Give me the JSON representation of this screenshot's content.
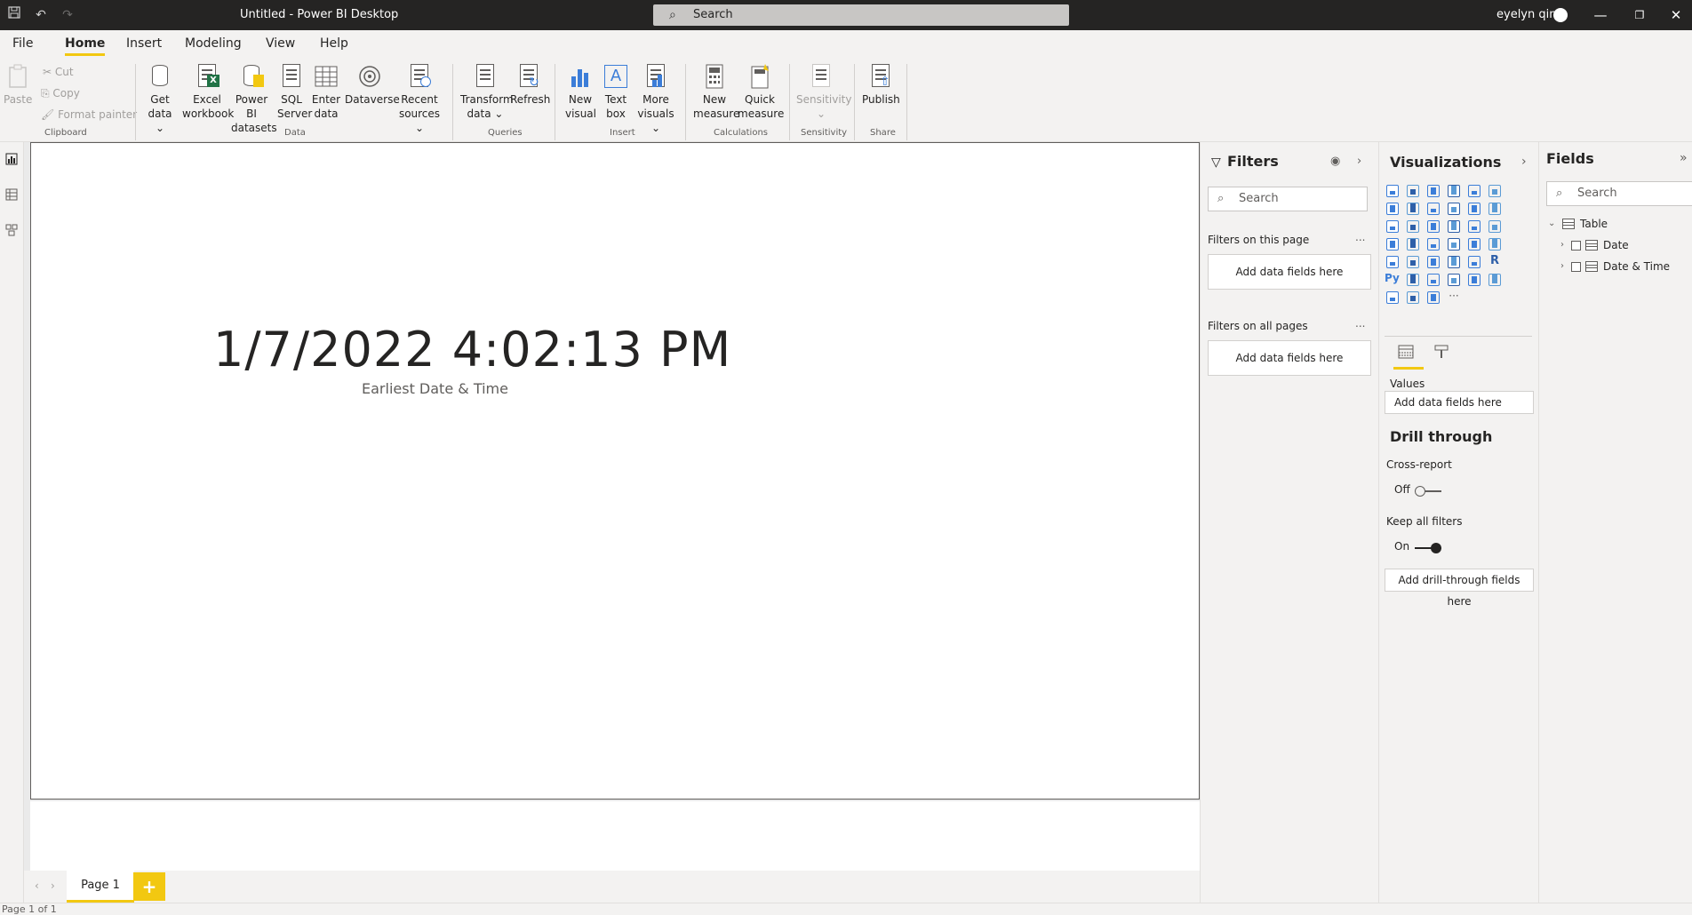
{
  "titlebar": {
    "title": "Untitled - Power BI Desktop",
    "search_placeholder": "Search",
    "user_name": "eyelyn qin"
  },
  "menu": {
    "tabs": [
      "File",
      "Home",
      "Insert",
      "Modeling",
      "View",
      "Help"
    ],
    "active": "Home"
  },
  "ribbon": {
    "clipboard": {
      "paste": "Paste",
      "cut": "Cut",
      "copy": "Copy",
      "format_painter": "Format painter",
      "group": "Clipboard"
    },
    "data": {
      "get_data": [
        "Get",
        "data ⌄"
      ],
      "excel": [
        "Excel",
        "workbook"
      ],
      "pbi_datasets": [
        "Power BI",
        "datasets"
      ],
      "sql": [
        "SQL",
        "Server"
      ],
      "enter_data": [
        "Enter",
        "data"
      ],
      "dataverse": "Dataverse",
      "recent": [
        "Recent",
        "sources ⌄"
      ],
      "group": "Data"
    },
    "queries": {
      "transform": [
        "Transform",
        "data ⌄"
      ],
      "refresh": "Refresh",
      "group": "Queries"
    },
    "insert": {
      "new_visual": [
        "New",
        "visual"
      ],
      "text_box": [
        "Text",
        "box"
      ],
      "more_visuals": [
        "More",
        "visuals ⌄"
      ],
      "group": "Insert"
    },
    "calculations": {
      "new_measure": [
        "New",
        "measure"
      ],
      "quick_measure": [
        "Quick",
        "measure"
      ],
      "group": "Calculations"
    },
    "sensitivity": {
      "label": "Sensitivity",
      "sub": "⌄",
      "group": "Sensitivity"
    },
    "share": {
      "publish": "Publish",
      "group": "Share"
    }
  },
  "canvas": {
    "card_value": "1/7/2022 4:02:13 PM",
    "card_label": "Earliest Date & Time"
  },
  "pages": {
    "tab": "Page 1",
    "add": "+",
    "status": "Page 1 of 1"
  },
  "filters": {
    "title": "Filters",
    "search_placeholder": "Search",
    "on_page": "Filters on this page",
    "on_all_pages": "Filters on all pages",
    "drop_text": "Add data fields here",
    "dots": "..."
  },
  "visualizations": {
    "title": "Visualizations",
    "values_label": "Values",
    "values_drop": "Add data fields here",
    "drill_title": "Drill through",
    "cross_report": "Cross-report",
    "cross_report_state": "Off",
    "keep_filters": "Keep all filters",
    "keep_filters_state": "On",
    "drill_drop": "Add drill-through fields here",
    "accent": "#f2c811"
  },
  "fields": {
    "title": "Fields",
    "search_placeholder": "Search",
    "table": "Table",
    "columns": [
      "Date",
      "Date & Time"
    ]
  }
}
